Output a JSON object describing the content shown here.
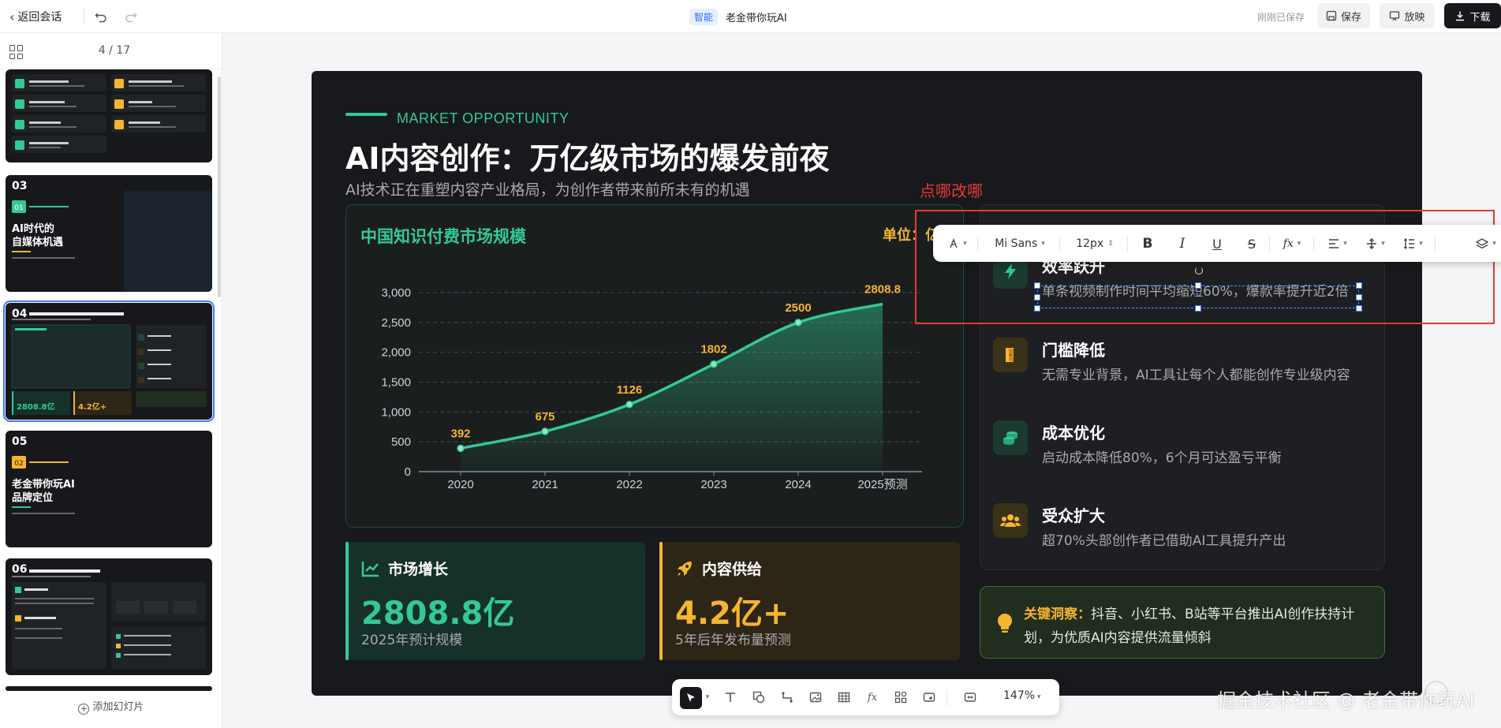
{
  "topbar": {
    "back_label": "返回会话",
    "tag": "智能",
    "doc_title": "老金带你玩AI",
    "save_status": "刚刚已保存",
    "save_label": "保存",
    "play_label": "放映",
    "download_label": "下载"
  },
  "sidebar": {
    "page_indicator": "4 / 17",
    "add_slide_label": "添加幻灯片",
    "thumbnails": [
      {
        "num": ""
      },
      {
        "num": "03",
        "title": "AI时代的自媒体机遇",
        "badge": "01"
      },
      {
        "num": "04",
        "title": "市场创作：万亿级市场的爆发前夜",
        "stat1": "2808.8亿",
        "stat2": "4.2亿+"
      },
      {
        "num": "05",
        "title": "老金带你玩AI品牌定位",
        "badge": "02"
      },
      {
        "num": "06",
        "title": "价值与差异化定位"
      }
    ]
  },
  "slide": {
    "eyebrow": "MARKET OPPORTUNITY",
    "title": "AI内容创作：万亿级市场的爆发前夜",
    "subtitle": "AI技术正在重塑内容产业格局，为创作者带来前所未有的机遇",
    "chart_title": "中国知识付费市场规模",
    "chart_unit": "单位：亿",
    "stats": [
      {
        "title": "市场增长",
        "value": "2808.8亿",
        "caption": "2025年预计规模",
        "color": "#34c994"
      },
      {
        "title": "内容供给",
        "value": "4.2亿+",
        "caption": "5年后年发布量预测",
        "color": "#f5b52e"
      }
    ],
    "benefits": [
      {
        "title": "效率跃升",
        "desc": "单条视频制作时间平均缩短60%，爆款率提升近2倍",
        "icon": "lightning-icon"
      },
      {
        "title": "门槛降低",
        "desc": "无需专业背景，AI工具让每个人都能创作专业级内容",
        "icon": "door-icon"
      },
      {
        "title": "成本优化",
        "desc": "启动成本降低80%，6个月可达盈亏平衡",
        "icon": "coins-icon"
      },
      {
        "title": "受众扩大",
        "desc": "超70%头部创作者已借助AI工具提升产出",
        "icon": "users-icon"
      }
    ],
    "insight": {
      "label": "关键洞察：",
      "text": "抖音、小红书、B站等平台推出AI创作扶持计划，为优质AI内容提供流量倾斜"
    }
  },
  "chart_data": {
    "type": "area",
    "title": "中国知识付费市场规模",
    "ylabel": "单位：亿",
    "categories": [
      "2020",
      "2021",
      "2022",
      "2023",
      "2024",
      "2025预测"
    ],
    "values": [
      392,
      675,
      1126,
      1802,
      2500,
      2808.8
    ],
    "yticks": [
      "0",
      "500",
      "1,000",
      "1,500",
      "2,000",
      "2,500",
      "3,000"
    ],
    "ylim": [
      0,
      3000
    ],
    "grid": true,
    "colors": {
      "line": "#34c994",
      "labels": "#f5b52e"
    }
  },
  "annotation": {
    "label": "点哪改哪"
  },
  "format_toolbar": {
    "font_family": "Mi Sans",
    "font_size": "12px"
  },
  "bottom_toolbar": {
    "zoom": "147%"
  },
  "watermark": "掘金技术社区 @ 老金带你玩AI"
}
